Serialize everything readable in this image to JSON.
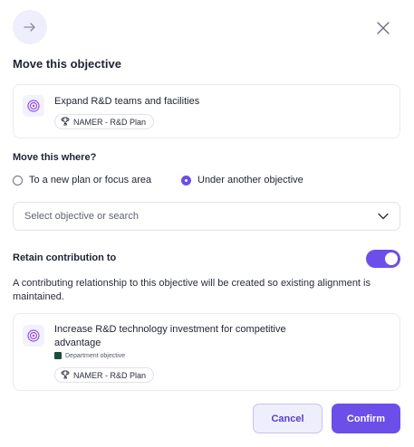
{
  "dialog": {
    "title": "Move this objective",
    "close_icon": "close-icon",
    "header_icon": "arrow-right-icon"
  },
  "current_objective": {
    "title": "Expand R&D teams and facilities",
    "plan": "NAMER - R&D Plan",
    "icon": "target-icon",
    "plan_icon": "trophy-icon"
  },
  "move_where": {
    "label": "Move this where?",
    "options": [
      {
        "label": "To a new plan or focus area",
        "checked": false
      },
      {
        "label": "Under another objective",
        "checked": true
      }
    ]
  },
  "objective_select": {
    "placeholder": "Select objective or search",
    "icon": "chevron-down-icon"
  },
  "retain": {
    "label": "Retain contribution to",
    "enabled": true,
    "description": "A contributing relationship to this objective will be created so existing alignment is maintained."
  },
  "retained_objective": {
    "title": "Increase R&D technology investment for competitive advantage",
    "type_label": "Department objective",
    "plan": "NAMER - R&D Plan",
    "icon": "target-icon",
    "plan_icon": "trophy-icon"
  },
  "actions": {
    "cancel_label": "Cancel",
    "confirm_label": "Confirm"
  },
  "colors": {
    "accent": "#6c4ee8",
    "accent_light": "#efeefd",
    "department_tag": "#1d4d3a"
  }
}
